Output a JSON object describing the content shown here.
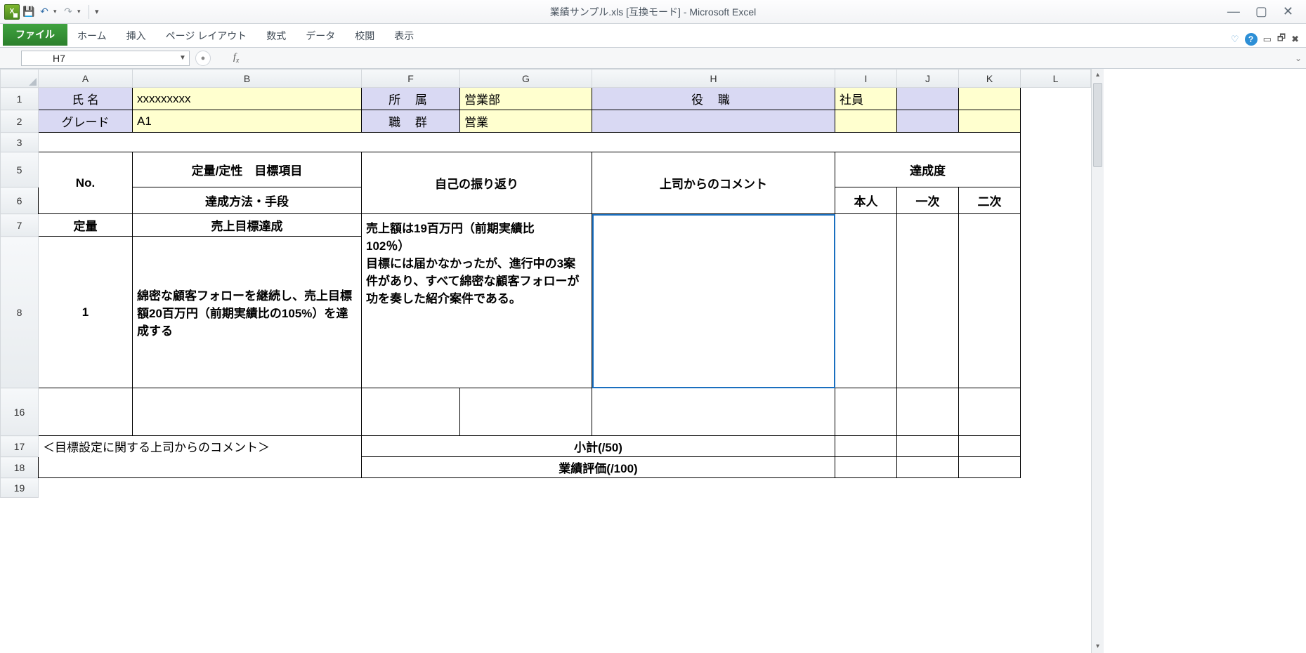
{
  "title": "業績サンプル.xls  [互換モード] - Microsoft Excel",
  "tabs": {
    "file": "ファイル",
    "home": "ホーム",
    "insert": "挿入",
    "pagelayout": "ページ レイアウト",
    "formulas": "数式",
    "data": "データ",
    "review": "校閲",
    "view": "表示"
  },
  "namebox": "H7",
  "fx": "fx",
  "cols": [
    "A",
    "B",
    "F",
    "G",
    "H",
    "I",
    "J",
    "K",
    "L"
  ],
  "rows": [
    "1",
    "2",
    "3",
    "5",
    "6",
    "7",
    "8",
    "16",
    "17",
    "18",
    "19"
  ],
  "r1": {
    "A": "氏 名",
    "B": "xxxxxxxxx",
    "F": "所 属",
    "G": "営業部",
    "H": "役 職",
    "I": "社員"
  },
  "r2": {
    "A": "グレード",
    "B": "A1",
    "F": "職 群",
    "G": "営業"
  },
  "hdr": {
    "no": "No.",
    "target": "定量/定性　目標項目",
    "method": "達成方法・手段",
    "selfreview": "自己の振り返り",
    "bosscomment": "上司からのコメント",
    "achieve": "達成度",
    "self": "本人",
    "first": "一次",
    "second": "二次"
  },
  "r7": {
    "A": "定量",
    "B": "売上目標達成"
  },
  "r8": {
    "A": "1",
    "B": "綿密な顧客フォローを継続し、売上目標額20百万円（前期実績比の105%）を達成する",
    "FG": "売上額は19百万円（前期実績比　102％）\n目標には届かなかったが、進行中の3案件があり、すべて綿密な顧客フォローが功を奏した紹介案件である。"
  },
  "r17": {
    "AB": "＜目標設定に関する上司からのコメント＞",
    "FH": "小計(/50)"
  },
  "r18": {
    "FH": "業績評価(/100)"
  }
}
